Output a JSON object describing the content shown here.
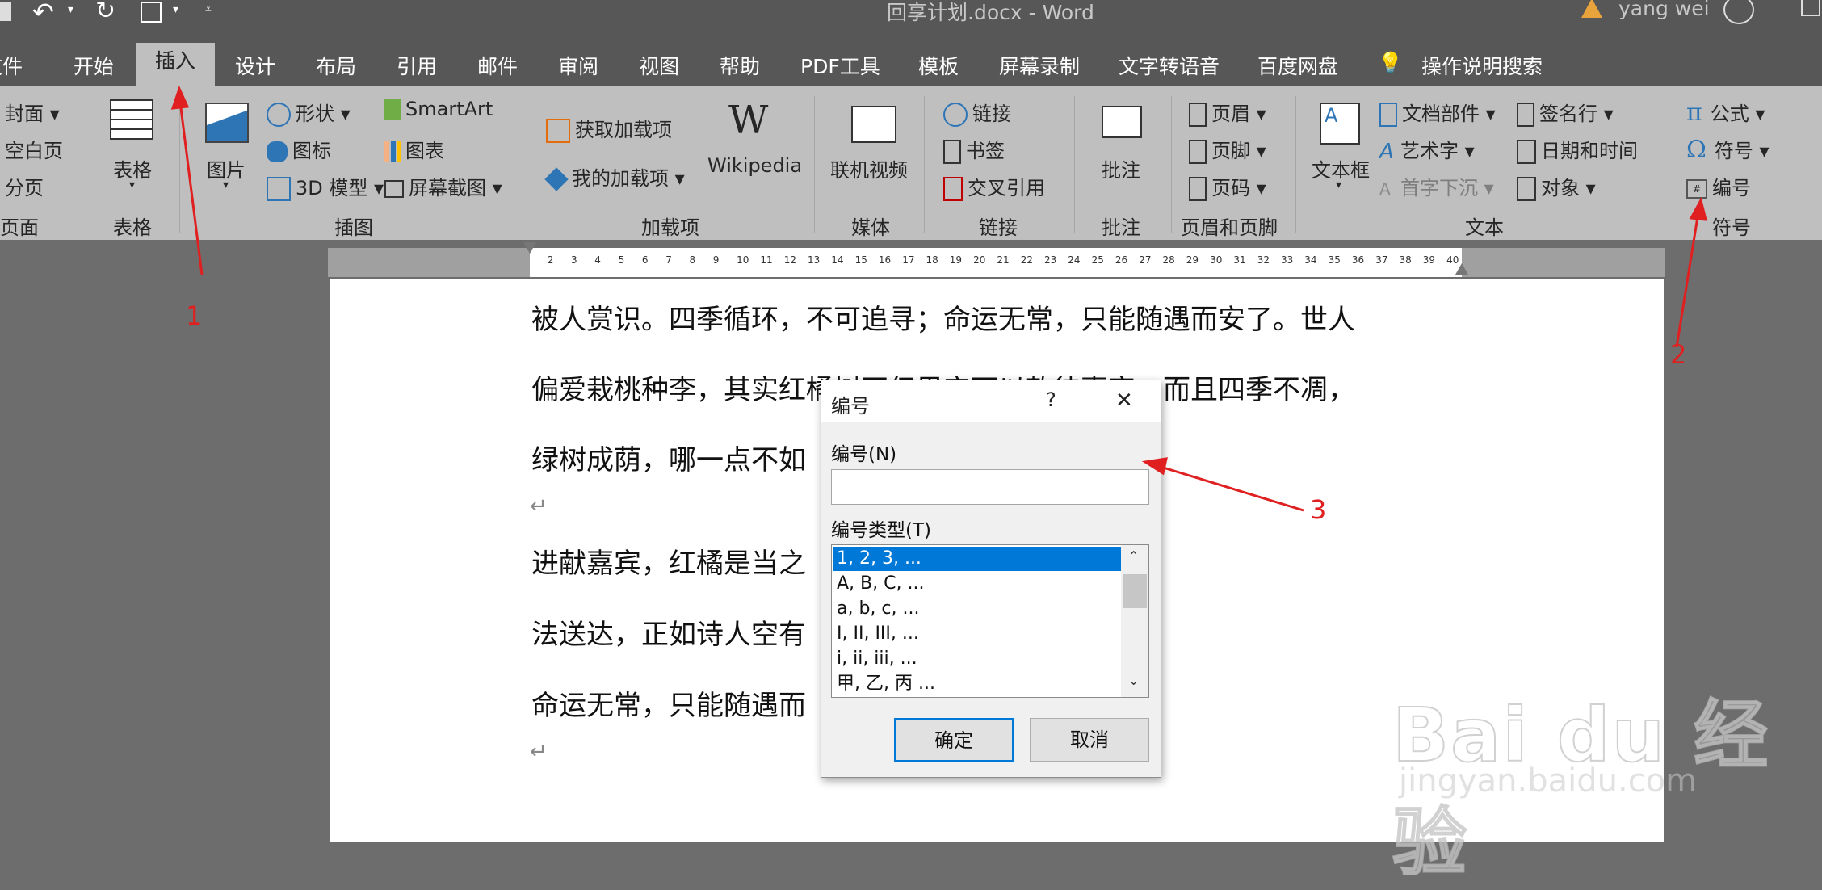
{
  "titlebar": {
    "doc_title": "回享计划.docx  -  Word",
    "user": "yang wei"
  },
  "tabs": [
    {
      "label": "文件"
    },
    {
      "label": "开始"
    },
    {
      "label": "插入"
    },
    {
      "label": "设计"
    },
    {
      "label": "布局"
    },
    {
      "label": "引用"
    },
    {
      "label": "邮件"
    },
    {
      "label": "审阅"
    },
    {
      "label": "视图"
    },
    {
      "label": "帮助"
    },
    {
      "label": "PDF工具"
    },
    {
      "label": "模板"
    },
    {
      "label": "屏幕录制"
    },
    {
      "label": "文字转语音"
    },
    {
      "label": "百度网盘"
    },
    {
      "label": "操作说明搜索"
    }
  ],
  "ribbon": {
    "pages": {
      "cover": "封面",
      "blank": "空白页",
      "break": "分页",
      "group": "页面"
    },
    "table": {
      "label": "表格",
      "group": "表格"
    },
    "illustrations": {
      "pictures": "图片",
      "shapes": "形状",
      "icons": "图标",
      "model3d": "3D 模型",
      "smartart": "SmartArt",
      "chart": "图表",
      "screenshot": "屏幕截图",
      "group": "插图"
    },
    "addins": {
      "get": "获取加载项",
      "mine": "我的加载项",
      "wikipedia": "Wikipedia",
      "group": "加载项"
    },
    "media": {
      "video": "联机视频",
      "group": "媒体"
    },
    "links": {
      "link": "链接",
      "bookmark": "书签",
      "crossref": "交叉引用",
      "group": "链接"
    },
    "comments": {
      "comment": "批注",
      "group": "批注"
    },
    "headerfooter": {
      "header": "页眉",
      "footer": "页脚",
      "pagenum": "页码",
      "group": "页眉和页脚"
    },
    "text": {
      "textbox": "文本框",
      "parts": "文档部件",
      "wordart": "艺术字",
      "dropcap": "首字下沉",
      "signature": "签名行",
      "datetime": "日期和时间",
      "object": "对象",
      "group": "文本"
    },
    "symbols": {
      "equation": "公式",
      "symbol": "符号",
      "number": "编号",
      "group": "符号"
    }
  },
  "document": {
    "lines": [
      "被人赏识。四季循环，不可追寻；命运无常，只能随遇而安了。世人",
      "偏爱栽桃种李，其实红橘树不但果实可以款待嘉宾，而且四季不凋，",
      "绿树成荫，哪一点不如",
      "进献嘉宾，红橘是当之",
      "法送达，正如诗人空有",
      "命运无常，只能随遇而"
    ]
  },
  "dialog": {
    "title": "编号",
    "help": "?",
    "close": "✕",
    "number_label": "编号(N)",
    "number_value": "",
    "type_label": "编号类型(T)",
    "types": [
      "1, 2, 3, ...",
      "A, B, C, ...",
      "a, b, c, ...",
      "I, II, III, ...",
      "i, ii, iii, ...",
      "甲, 乙, 丙 ..."
    ],
    "selected_index": 0,
    "ok": "确定",
    "cancel": "取消"
  },
  "annotations": [
    "1",
    "2",
    "3"
  ],
  "watermark": {
    "brand": "Bai du 经验",
    "url": "jingyan.baidu.com"
  },
  "colors": {
    "accent": "#0078d7",
    "annotation": "#e02020",
    "tab_bar": "#575757",
    "ribbon": "#bfbfbf"
  }
}
